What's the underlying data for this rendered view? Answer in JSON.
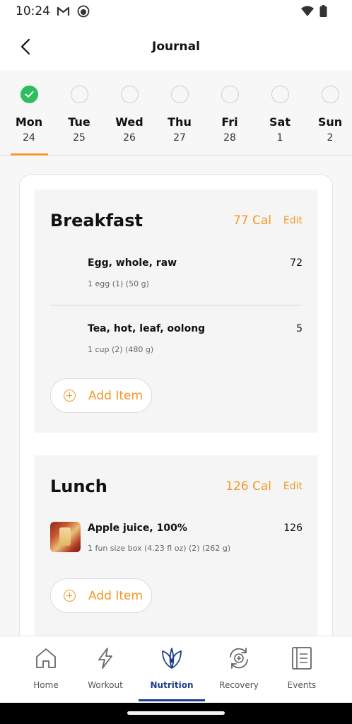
{
  "status_bar": {
    "time": "10:24",
    "icons": [
      "gmail-icon",
      "notification-face-icon",
      "wifi-icon",
      "battery-icon"
    ]
  },
  "app_bar": {
    "title": "Journal",
    "back_icon": "chevron-left-icon"
  },
  "days": [
    {
      "name": "Mon",
      "date": "24",
      "completed": true,
      "selected": true
    },
    {
      "name": "Tue",
      "date": "25",
      "completed": false,
      "selected": false
    },
    {
      "name": "Wed",
      "date": "26",
      "completed": false,
      "selected": false
    },
    {
      "name": "Thu",
      "date": "27",
      "completed": false,
      "selected": false
    },
    {
      "name": "Fri",
      "date": "28",
      "completed": false,
      "selected": false
    },
    {
      "name": "Sat",
      "date": "1",
      "completed": false,
      "selected": false
    },
    {
      "name": "Sun",
      "date": "2",
      "completed": false,
      "selected": false
    }
  ],
  "meals": [
    {
      "title": "Breakfast",
      "calories": "77 Cal",
      "edit_label": "Edit",
      "items": [
        {
          "name": "Egg, whole, raw",
          "serving": "1 egg (1) (50 g)",
          "calories": "72"
        },
        {
          "name": "Tea, hot, leaf, oolong",
          "serving": "1 cup (2) (480 g)",
          "calories": "5"
        }
      ],
      "add_label": "Add Item"
    },
    {
      "title": "Lunch",
      "calories": "126 Cal",
      "edit_label": "Edit",
      "items": [
        {
          "name": "Apple juice, 100%",
          "serving": "1 fun size box (4.23 fl oz) (2) (262 g)",
          "calories": "126"
        }
      ],
      "add_label": "Add Item"
    }
  ],
  "bottom_nav": {
    "items": [
      {
        "label": "Home",
        "icon": "home-icon",
        "active": false
      },
      {
        "label": "Workout",
        "icon": "lightning-icon",
        "active": false
      },
      {
        "label": "Nutrition",
        "icon": "leaf-icon",
        "active": true
      },
      {
        "label": "Recovery",
        "icon": "recovery-icon",
        "active": false
      },
      {
        "label": "Events",
        "icon": "events-icon",
        "active": false
      }
    ]
  },
  "colors": {
    "accent": "#f09a2a",
    "success": "#2ebd5f",
    "nav_active": "#1b3d8a"
  }
}
